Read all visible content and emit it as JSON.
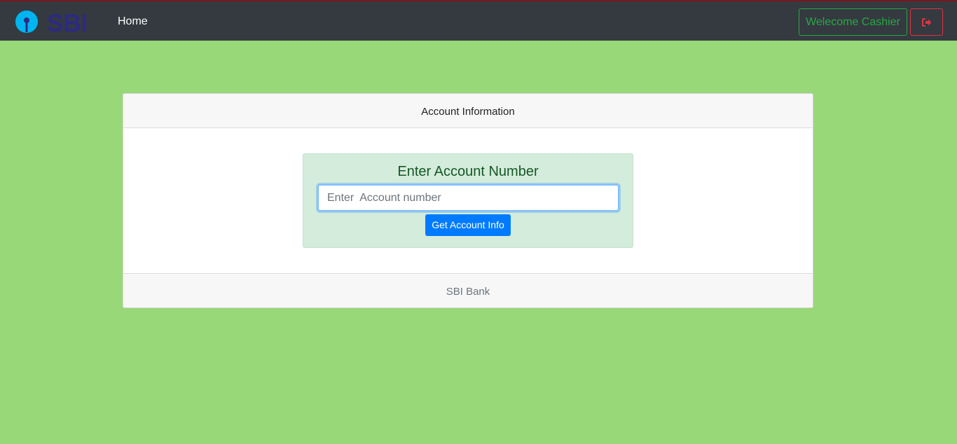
{
  "navbar": {
    "logo_text": "SBI",
    "home_label": "Home",
    "welcome_label": "Welecome Cashier",
    "logout_icon": "sign-out-icon"
  },
  "card": {
    "header_title": "Account Information",
    "form": {
      "heading": "Enter Account Number",
      "input_placeholder": "Enter  Account number",
      "input_value": "",
      "submit_label": "Get Account Info"
    },
    "footer_text": "SBI Bank"
  },
  "colors": {
    "page_background": "#98d878",
    "navbar": "#343a40",
    "success": "#28a745",
    "danger": "#dc3545",
    "primary": "#007bff",
    "logo_blue": "#2c2a83",
    "logo_keyhole": "#00b5ef"
  }
}
